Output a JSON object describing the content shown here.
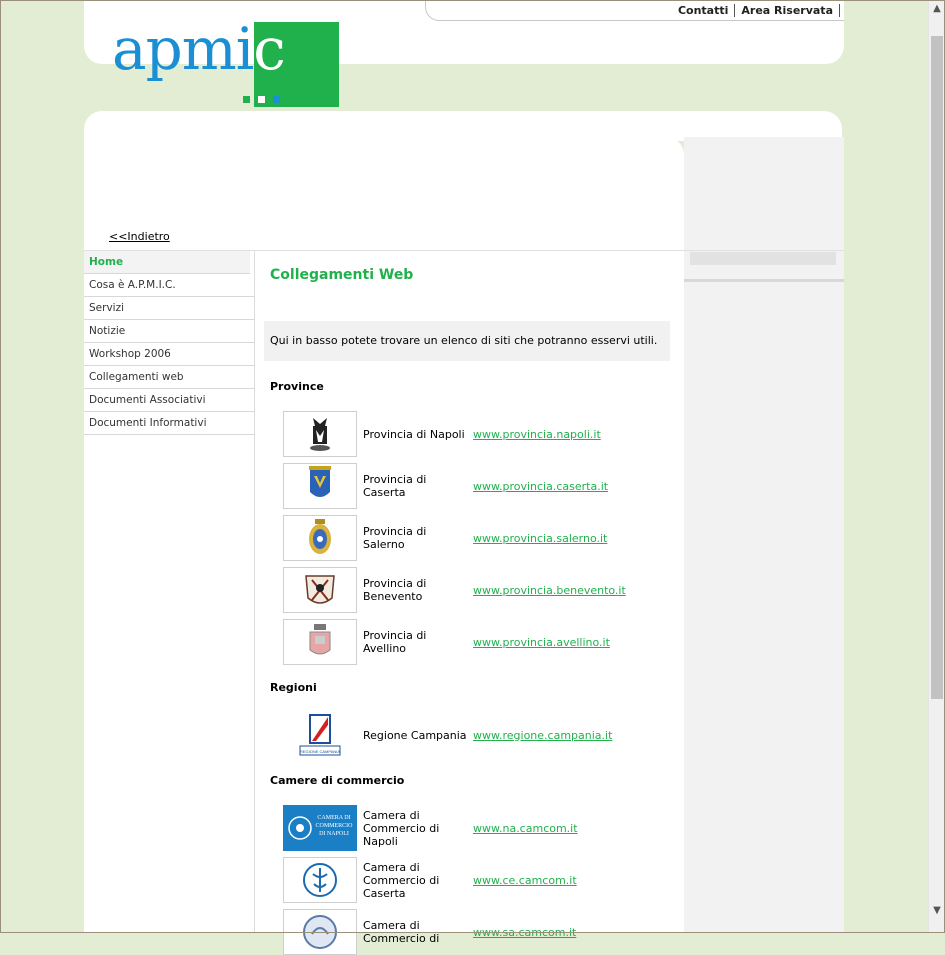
{
  "header": {
    "logo_text": "apmi",
    "logo_text_c": "c",
    "links": [
      "Contatti",
      "Area Riservata"
    ]
  },
  "back_link": "<<Indietro",
  "sidebar": {
    "items": [
      {
        "label": "Home"
      },
      {
        "label": "Cosa è A.P.M.I.C."
      },
      {
        "label": "Servizi"
      },
      {
        "label": "Notizie"
      },
      {
        "label": "Workshop 2006"
      },
      {
        "label": "Collegamenti web"
      },
      {
        "label": "Documenti Associativi"
      },
      {
        "label": "Documenti Informativi"
      }
    ]
  },
  "main": {
    "title": "Collegamenti Web",
    "intro": "Qui in basso potete trovare un elenco di siti che potranno esservi utili.",
    "sections": [
      {
        "heading": "Province"
      },
      {
        "heading": "Regioni"
      },
      {
        "heading": "Camere di commercio"
      }
    ],
    "province": [
      {
        "name": "Provincia di Napoli",
        "url": "www.provincia.napoli.it"
      },
      {
        "name": "Provincia di Caserta",
        "url": "www.provincia.caserta.it"
      },
      {
        "name": "Provincia di Salerno",
        "url": "www.provincia.salerno.it"
      },
      {
        "name": "Provincia di Benevento",
        "url": "www.provincia.benevento.it"
      },
      {
        "name": "Provincia di Avellino",
        "url": "www.provincia.avellino.it"
      }
    ],
    "regioni": [
      {
        "name": "Regione Campania",
        "url": "www.regione.campania.it",
        "logo_caption": "REGIONE CAMPANIA"
      }
    ],
    "camere": [
      {
        "name": "Camera di Commercio di Napoli",
        "url": "www.na.camcom.it",
        "logo_caption": "CAMERA DI COMMERCIO DI NAPOLI"
      },
      {
        "name": "Camera di Commercio di Caserta",
        "url": "www.ce.camcom.it"
      },
      {
        "name": "Camera di Commercio di",
        "url": "www.sa.camcom.it"
      }
    ]
  },
  "colors": {
    "accent": "#21b14c",
    "logo_blue": "#1b8fd4",
    "background": "#e3edd3"
  }
}
